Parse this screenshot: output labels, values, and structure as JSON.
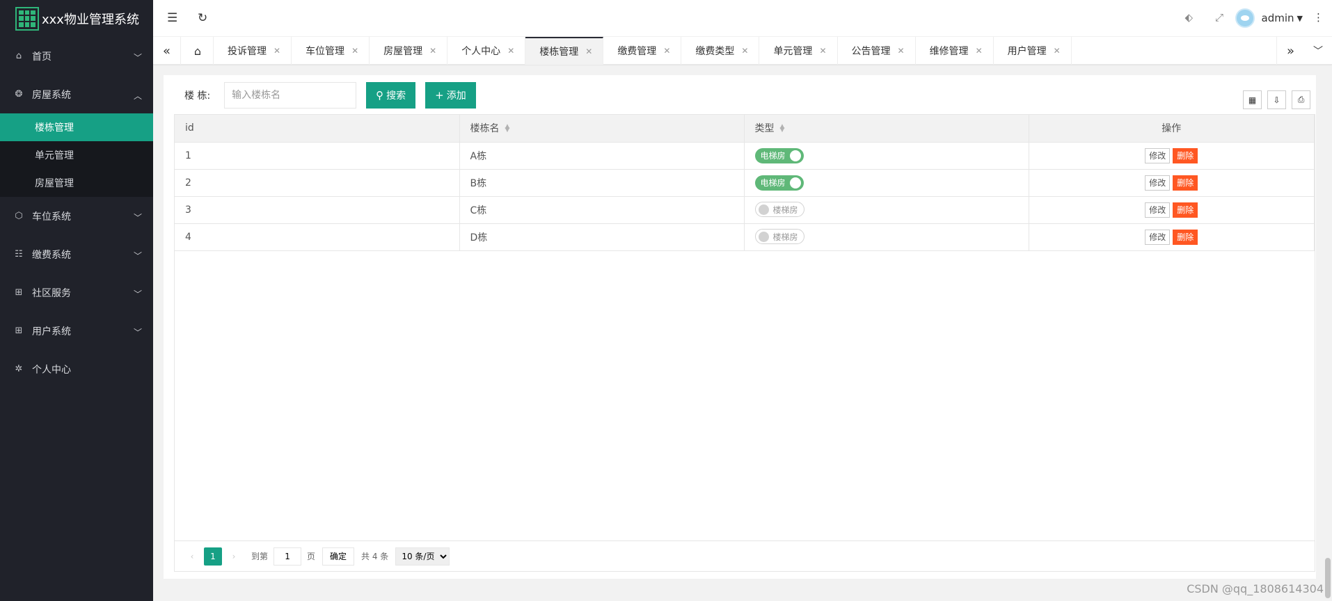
{
  "app": {
    "title": "xxx物业管理系统"
  },
  "sidebar": {
    "items": [
      {
        "label": "首页",
        "icon": "home-icon"
      },
      {
        "label": "房屋系统",
        "icon": "gear-icon"
      },
      {
        "label": "车位系统",
        "icon": "cube-icon"
      },
      {
        "label": "缴费系统",
        "icon": "list-icon"
      },
      {
        "label": "社区服务",
        "icon": "apps-icon"
      },
      {
        "label": "用户系统",
        "icon": "apps-icon"
      },
      {
        "label": "个人中心",
        "icon": "settings-icon"
      }
    ],
    "sub_items": [
      {
        "label": "楼栋管理"
      },
      {
        "label": "单元管理"
      },
      {
        "label": "房屋管理"
      }
    ]
  },
  "header": {
    "user": "admin"
  },
  "tabs": [
    {
      "label": "投诉管理"
    },
    {
      "label": "车位管理"
    },
    {
      "label": "房屋管理"
    },
    {
      "label": "个人中心"
    },
    {
      "label": "楼栋管理"
    },
    {
      "label": "缴费管理"
    },
    {
      "label": "缴费类型"
    },
    {
      "label": "单元管理"
    },
    {
      "label": "公告管理"
    },
    {
      "label": "维修管理"
    },
    {
      "label": "用户管理"
    }
  ],
  "search": {
    "label": "楼 栋:",
    "placeholder": "输入楼栋名",
    "search_label": "搜索",
    "add_label": "添加"
  },
  "table": {
    "headers": [
      "id",
      "楼栋名",
      "类型",
      "操作"
    ],
    "rows": [
      {
        "id": "1",
        "name": "A栋",
        "type": "电梯房",
        "on": true
      },
      {
        "id": "2",
        "name": "B栋",
        "type": "电梯房",
        "on": true
      },
      {
        "id": "3",
        "name": "C栋",
        "type": "楼梯房",
        "on": false
      },
      {
        "id": "4",
        "name": "D栋",
        "type": "楼梯房",
        "on": false
      }
    ],
    "edit_label": "修改",
    "delete_label": "删除"
  },
  "pager": {
    "current": "1",
    "goto_label": "到第",
    "page_value": "1",
    "page_unit": "页",
    "confirm_label": "确定",
    "total": "共 4 条",
    "page_size": "10 条/页"
  },
  "watermark": "CSDN @qq_1808614304",
  "colors": {
    "accent": "#16a085",
    "sidebar": "#20222a",
    "danger": "#ff5722",
    "switch_on": "#5fb878"
  }
}
